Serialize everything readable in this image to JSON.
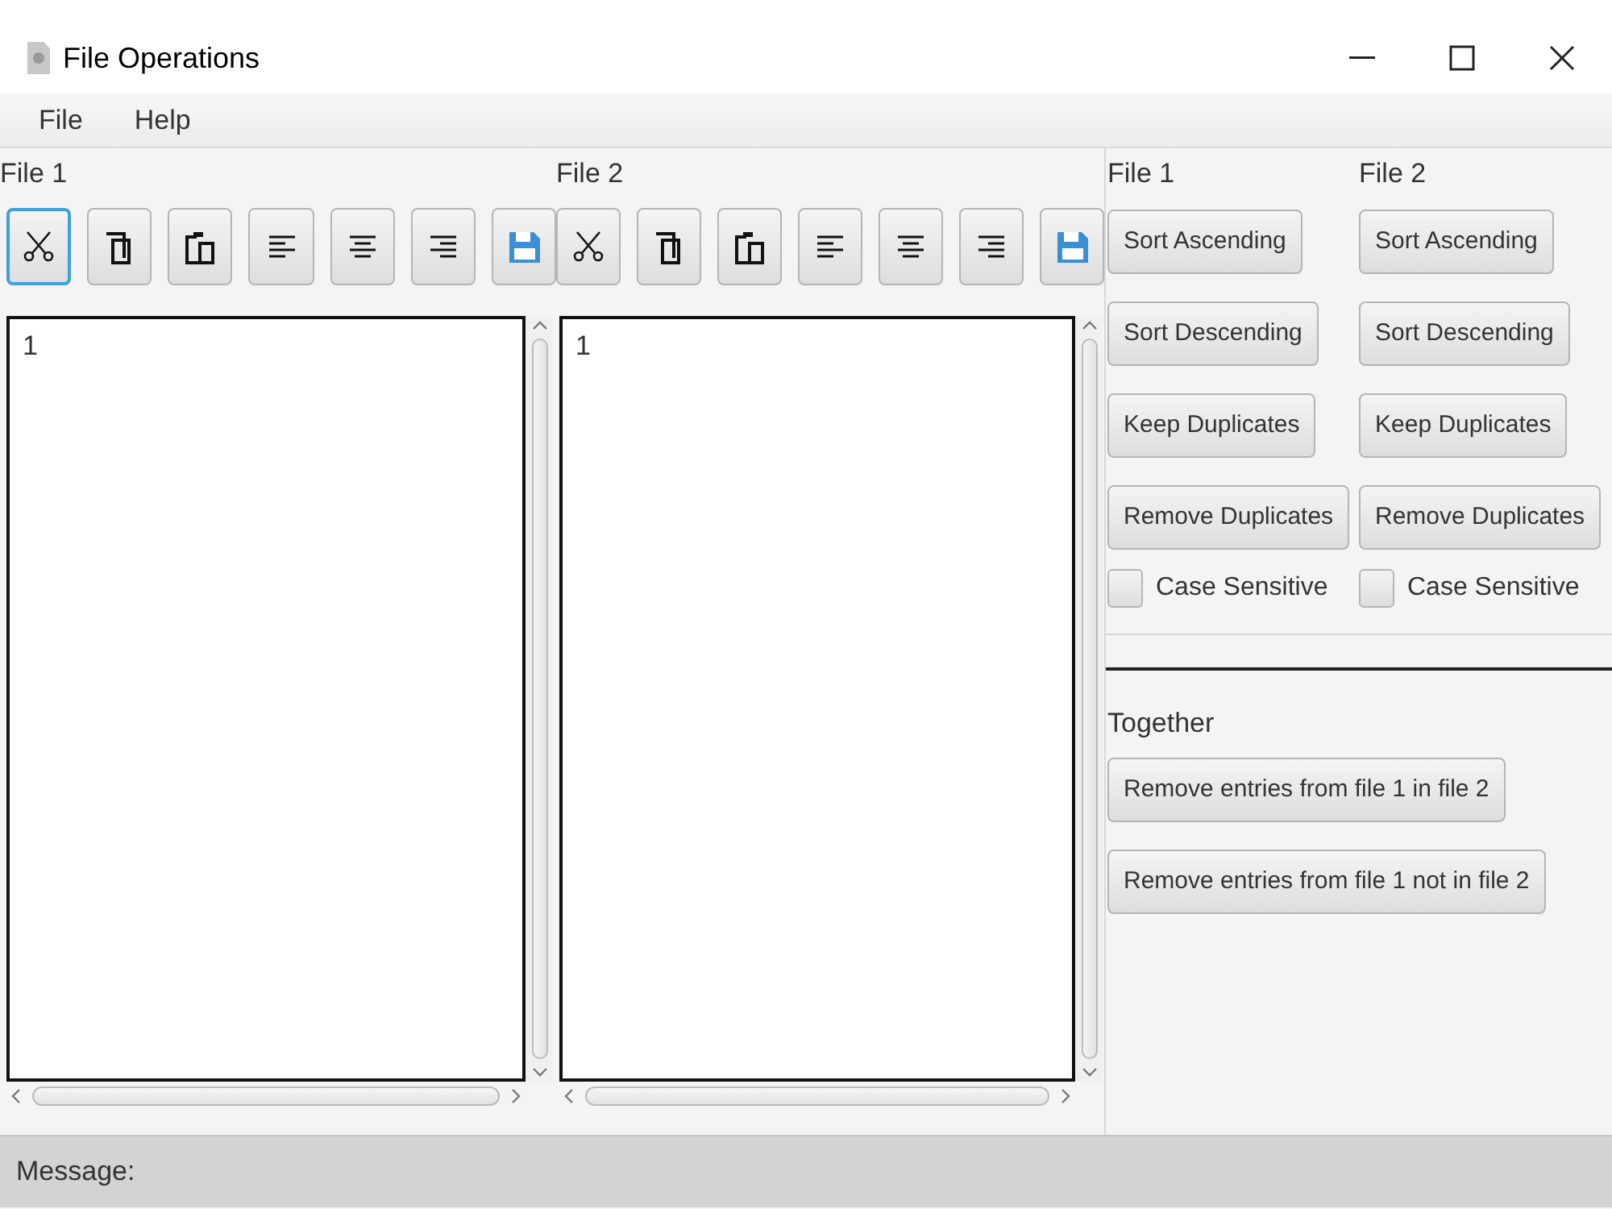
{
  "window": {
    "title": "File Operations"
  },
  "menu": [
    {
      "label": "File"
    },
    {
      "label": "Help"
    }
  ],
  "editors": [
    {
      "label": "File 1",
      "lines": [
        "1"
      ],
      "tools": [
        {
          "kind": "cut",
          "focused": true
        },
        {
          "kind": "copy",
          "focused": false
        },
        {
          "kind": "paste",
          "focused": false
        },
        {
          "kind": "align-left",
          "focused": false
        },
        {
          "kind": "align-center",
          "focused": false
        },
        {
          "kind": "align-right",
          "focused": false
        },
        {
          "kind": "save",
          "focused": false
        }
      ]
    },
    {
      "label": "File 2",
      "lines": [
        "1"
      ],
      "tools": [
        {
          "kind": "cut",
          "focused": false
        },
        {
          "kind": "copy",
          "focused": false
        },
        {
          "kind": "paste",
          "focused": false
        },
        {
          "kind": "align-left",
          "focused": false
        },
        {
          "kind": "align-center",
          "focused": false
        },
        {
          "kind": "align-right",
          "focused": false
        },
        {
          "kind": "save",
          "focused": false
        }
      ]
    }
  ],
  "operations": {
    "columns": [
      {
        "label": "File 1",
        "buttons": [
          "Sort Ascending",
          "Sort Descending",
          "Keep Duplicates",
          "Remove Duplicates"
        ],
        "checkbox": {
          "label": "Case Sensitive",
          "checked": false
        }
      },
      {
        "label": "File 2",
        "buttons": [
          "Sort Ascending",
          "Sort Descending",
          "Keep Duplicates",
          "Remove Duplicates"
        ],
        "checkbox": {
          "label": "Case Sensitive",
          "checked": false
        }
      }
    ],
    "together": {
      "label": "Together",
      "buttons": [
        "Remove entries from file 1 in file 2",
        "Remove entries from file 1 not in file 2"
      ]
    }
  },
  "status_bar": {
    "label": "Message:"
  }
}
